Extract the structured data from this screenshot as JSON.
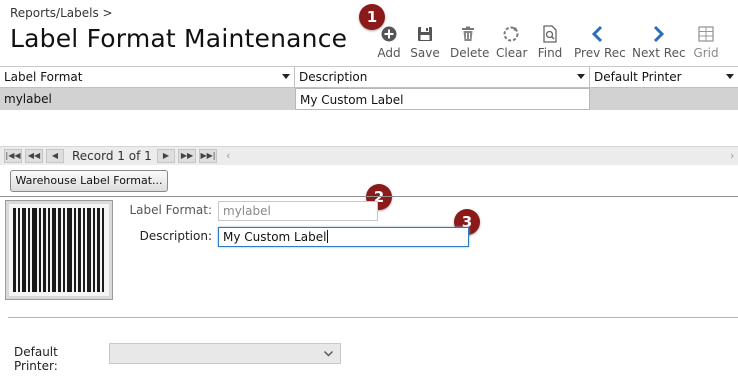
{
  "breadcrumb": "Reports/Labels >",
  "page_title": "Label Format Maintenance",
  "toolbar": {
    "add": "Add",
    "save": "Save",
    "delete": "Delete",
    "clear": "Clear",
    "find": "Find",
    "prev": "Prev Rec",
    "next": "Next Rec",
    "grid": "Grid"
  },
  "callouts": [
    "1",
    "2",
    "3"
  ],
  "grid": {
    "columns": [
      "Label Format",
      "Description",
      "Default Printer"
    ],
    "rows": [
      {
        "label_format": "mylabel",
        "description": "My Custom Label",
        "default_printer": ""
      }
    ]
  },
  "pager": {
    "text": "Record 1 of 1",
    "first_icon": "first-record-icon",
    "prev_page_icon": "prev-page-icon",
    "prev_icon": "prev-record-icon",
    "next_icon": "next-record-icon",
    "next_page_icon": "next-page-icon",
    "last_icon": "last-record-icon"
  },
  "warehouse_button": "Warehouse Label Format...",
  "form": {
    "label_format_label": "Label Format:",
    "label_format_value": "mylabel",
    "description_label": "Description:",
    "description_value": "My Custom Label",
    "default_printer_label": "Default Printer:",
    "default_printer_value": ""
  },
  "colors": {
    "callout": "#8b1a1a",
    "accent_blue": "#2a6ebf",
    "toolbar_gray": "#555555"
  }
}
